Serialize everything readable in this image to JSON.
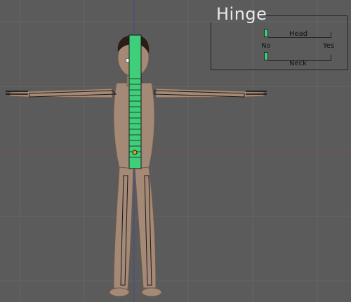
{
  "panel": {
    "title": "Hinge",
    "head": {
      "label": "Head",
      "value": 0
    },
    "range": {
      "min_label": "No",
      "max_label": "Yes"
    },
    "neck": {
      "label": "Neck",
      "value": 0
    }
  },
  "colors": {
    "background": "#5b5b5b",
    "grid": "#6a6a6a",
    "axis_red": "#8a4a4a",
    "axis_blue": "#4a4a8a",
    "skin": "#a48976",
    "bone": "#3fcf7a",
    "hair": "#2b1d16"
  },
  "icons": {
    "panel_handle": "slider-handle-icon"
  }
}
